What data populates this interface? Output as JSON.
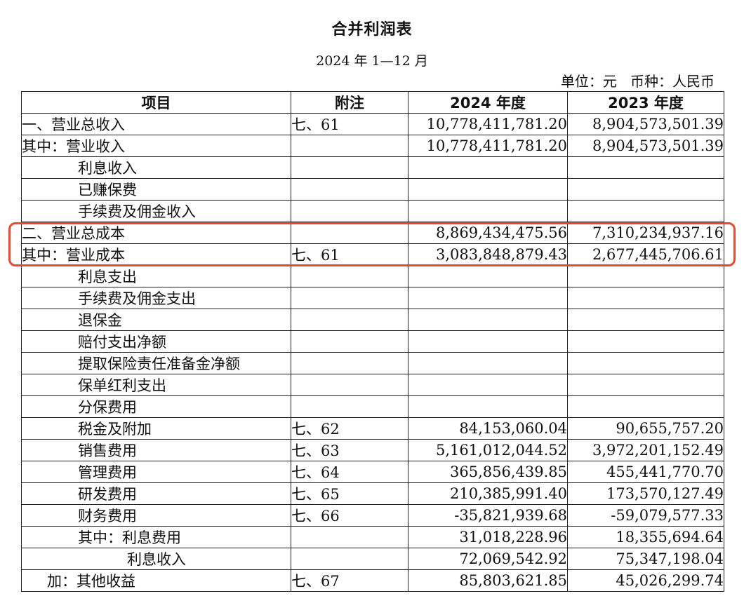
{
  "title": "合并利润表",
  "period": "2024 年 1—12 月",
  "unit_line": "单位：元   币种：人民币",
  "headers": {
    "item": "项目",
    "note": "附注",
    "y2024": "2024 年度",
    "y2023": "2023 年度"
  },
  "rows": [
    {
      "item": "一、营业总收入",
      "level": 0,
      "note": "七、61",
      "y2024": "10,778,411,781.20",
      "y2023": "8,904,573,501.39"
    },
    {
      "item": "其中：营业收入",
      "level": 0,
      "note": "",
      "y2024": "10,778,411,781.20",
      "y2023": "8,904,573,501.39"
    },
    {
      "item": "利息收入",
      "level": 1,
      "note": "",
      "y2024": "",
      "y2023": ""
    },
    {
      "item": "已赚保费",
      "level": 1,
      "note": "",
      "y2024": "",
      "y2023": ""
    },
    {
      "item": "手续费及佣金收入",
      "level": 1,
      "note": "",
      "y2024": "",
      "y2023": ""
    },
    {
      "item": "二、营业总成本",
      "level": 0,
      "note": "",
      "y2024": "8,869,434,475.56",
      "y2023": "7,310,234,937.16"
    },
    {
      "item": "其中：营业成本",
      "level": 0,
      "note": "七、61",
      "y2024": "3,083,848,879.43",
      "y2023": "2,677,445,706.61"
    },
    {
      "item": "利息支出",
      "level": 1,
      "note": "",
      "y2024": "",
      "y2023": ""
    },
    {
      "item": "手续费及佣金支出",
      "level": 1,
      "note": "",
      "y2024": "",
      "y2023": ""
    },
    {
      "item": "退保金",
      "level": 1,
      "note": "",
      "y2024": "",
      "y2023": ""
    },
    {
      "item": "赔付支出净额",
      "level": 1,
      "note": "",
      "y2024": "",
      "y2023": ""
    },
    {
      "item": "提取保险责任准备金净额",
      "level": 1,
      "note": "",
      "y2024": "",
      "y2023": ""
    },
    {
      "item": "保单红利支出",
      "level": 1,
      "note": "",
      "y2024": "",
      "y2023": ""
    },
    {
      "item": "分保费用",
      "level": 1,
      "note": "",
      "y2024": "",
      "y2023": ""
    },
    {
      "item": "税金及附加",
      "level": 1,
      "note": "七、62",
      "y2024": "84,153,060.04",
      "y2023": "90,655,757.20"
    },
    {
      "item": "销售费用",
      "level": 1,
      "note": "七、63",
      "y2024": "5,161,012,044.52",
      "y2023": "3,972,201,152.49"
    },
    {
      "item": "管理费用",
      "level": 1,
      "note": "七、64",
      "y2024": "365,856,439.85",
      "y2023": "455,441,770.70"
    },
    {
      "item": "研发费用",
      "level": 1,
      "note": "七、65",
      "y2024": "210,385,991.40",
      "y2023": "173,570,127.49"
    },
    {
      "item": "财务费用",
      "level": 1,
      "note": "七、66",
      "y2024": "-35,821,939.68",
      "y2023": "-59,079,577.33"
    },
    {
      "item": "其中：利息费用",
      "level": 1,
      "note": "",
      "y2024": "31,018,228.96",
      "y2023": "18,355,694.64"
    },
    {
      "item": "利息收入",
      "level": 2,
      "note": "",
      "y2024": "72,069,542.92",
      "y2023": "75,347,198.04"
    },
    {
      "item": "加：其他收益",
      "level": 3,
      "note": "七、67",
      "y2024": "85,803,621.85",
      "y2023": "45,026,299.74"
    }
  ],
  "highlight_color": "#e8492f"
}
